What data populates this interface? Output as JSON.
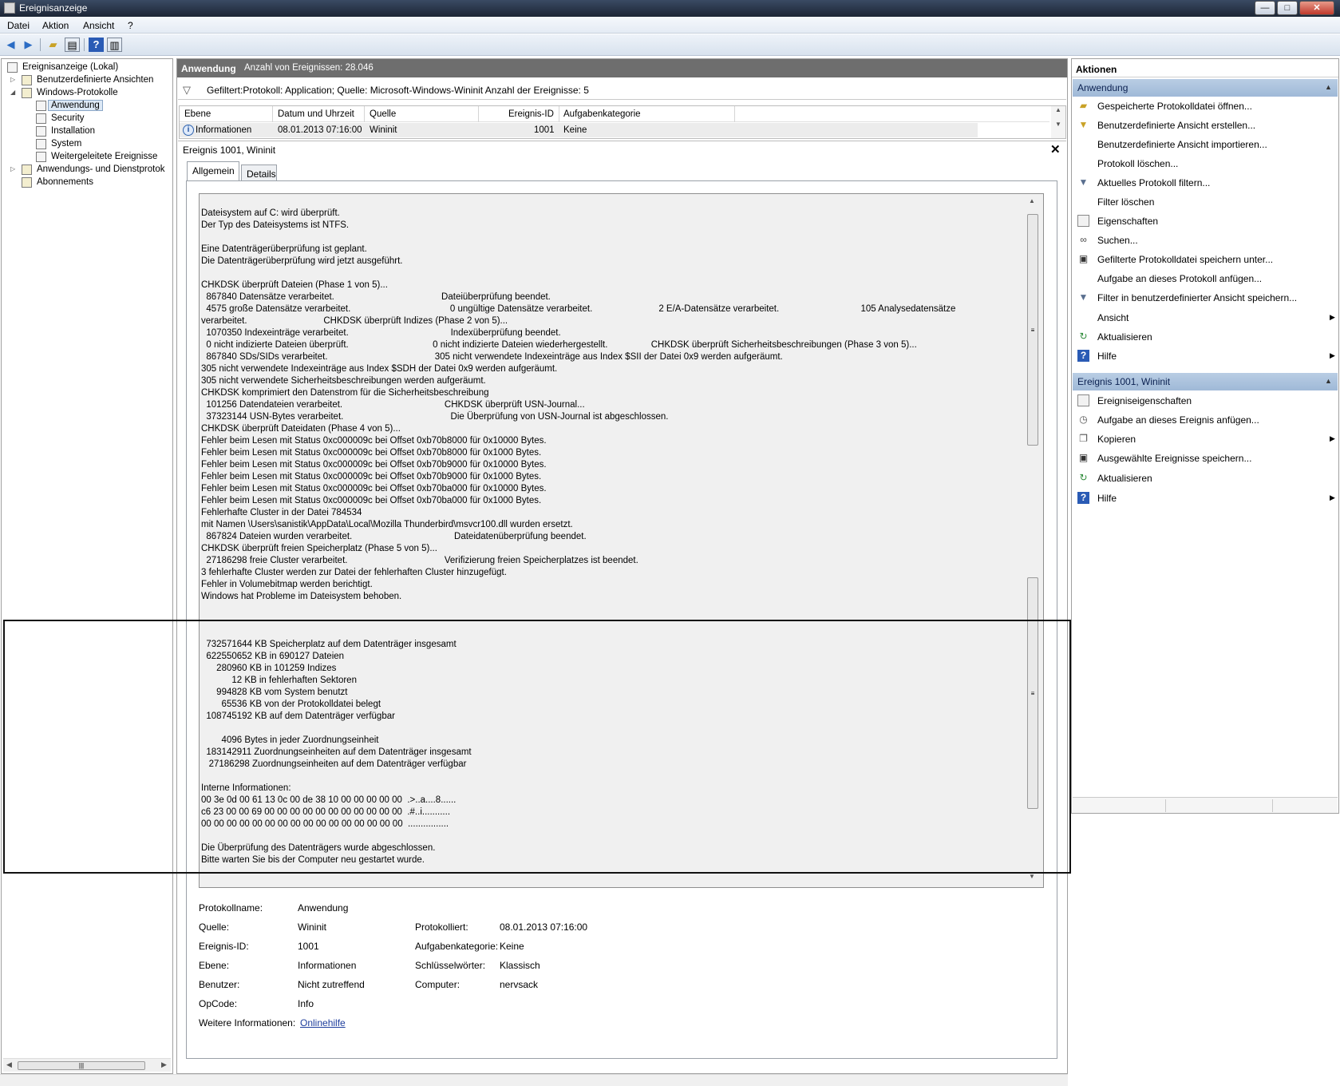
{
  "window": {
    "title": "Ereignisanzeige"
  },
  "menu": [
    "Datei",
    "Aktion",
    "Ansicht",
    "?"
  ],
  "tree": {
    "items": [
      {
        "label": "Ereignisanzeige (Lokal)"
      },
      {
        "label": "Benutzerdefinierte Ansichten"
      },
      {
        "label": "Windows-Protokolle"
      },
      {
        "label": "Anwendung"
      },
      {
        "label": "Security"
      },
      {
        "label": "Installation"
      },
      {
        "label": "System"
      },
      {
        "label": "Weitergeleitete Ereignisse"
      },
      {
        "label": "Anwendungs- und Dienstprotok"
      },
      {
        "label": "Abonnements"
      }
    ]
  },
  "center": {
    "header_title": "Anwendung",
    "header_count": "Anzahl von Ereignissen: 28.046",
    "filter_text": "Gefiltert:Protokoll: Application; Quelle: Microsoft-Windows-Wininit Anzahl der Ereignisse: 5",
    "columns": [
      "Ebene",
      "Datum und Uhrzeit",
      "Quelle",
      "Ereignis-ID",
      "Aufgabenkategorie"
    ],
    "row": {
      "level": "Informationen",
      "datetime": "08.01.2013 07:16:00",
      "source": "Wininit",
      "event_id": "1001",
      "category": "Keine"
    },
    "detail_title": "Ereignis 1001, Wininit",
    "tabs": [
      "Allgemein",
      "Details"
    ]
  },
  "message": {
    "text": "Dateisystem auf C: wird überprüft.\nDer Typ des Dateisystems ist NTFS.\n\nEine Datenträgerüberprüfung ist geplant.\nDie Datenträgerüberprüfung wird jetzt ausgeführt.\n\nCHKDSK überprüft Dateien (Phase 1 von 5)...\n  867840 Datensätze verarbeitet.                                          Dateiüberprüfung beendet.\n  4575 große Datensätze verarbeitet.                                       0 ungültige Datensätze verarbeitet.                          2 E/A-Datensätze verarbeitet.                                105 Analysedatensätze\nverarbeitet.                              CHKDSK überprüft Indizes (Phase 2 von 5)...\n  1070350 Indexeinträge verarbeitet.                                        Indexüberprüfung beendet.\n  0 nicht indizierte Dateien überprüft.                                 0 nicht indizierte Dateien wiederhergestellt.                 CHKDSK überprüft Sicherheitsbeschreibungen (Phase 3 von 5)...\n  867840 SDs/SIDs verarbeitet.                                          305 nicht verwendete Indexeinträge aus Index $SII der Datei 0x9 werden aufgeräumt.\n305 nicht verwendete Indexeinträge aus Index $SDH der Datei 0x9 werden aufgeräumt.\n305 nicht verwendete Sicherheitsbeschreibungen werden aufgeräumt.\nCHKDSK komprimiert den Datenstrom für die Sicherheitsbeschreibung\n  101256 Datendateien verarbeitet.                                        CHKDSK überprüft USN-Journal...\n  37323144 USN-Bytes verarbeitet.                                          Die Überprüfung von USN-Journal ist abgeschlossen.\nCHKDSK überprüft Dateidaten (Phase 4 von 5)...\nFehler beim Lesen mit Status 0xc000009c bei Offset 0xb70b8000 für 0x10000 Bytes.\nFehler beim Lesen mit Status 0xc000009c bei Offset 0xb70b8000 für 0x1000 Bytes.\nFehler beim Lesen mit Status 0xc000009c bei Offset 0xb70b9000 für 0x10000 Bytes.\nFehler beim Lesen mit Status 0xc000009c bei Offset 0xb70b9000 für 0x1000 Bytes.\nFehler beim Lesen mit Status 0xc000009c bei Offset 0xb70ba000 für 0x10000 Bytes.\nFehler beim Lesen mit Status 0xc000009c bei Offset 0xb70ba000 für 0x1000 Bytes.\nFehlerhafte Cluster in der Datei 784534\nmit Namen \\Users\\sanistik\\AppData\\Local\\Mozilla Thunderbird\\msvcr100.dll wurden ersetzt.\n  867824 Dateien wurden verarbeitet.                                        Dateidatenüberprüfung beendet.\nCHKDSK überprüft freien Speicherplatz (Phase 5 von 5)...\n  27186298 freie Cluster verarbeitet.                                      Verifizierung freien Speicherplatzes ist beendet.\n3 fehlerhafte Cluster werden zur Datei der fehlerhaften Cluster hinzugefügt.\nFehler in Volumebitmap werden berichtigt.\nWindows hat Probleme im Dateisystem behoben.\n\n\n\n  732571644 KB Speicherplatz auf dem Datenträger insgesamt\n  622550652 KB in 690127 Dateien\n      280960 KB in 101259 Indizes\n            12 KB in fehlerhaften Sektoren\n      994828 KB vom System benutzt\n        65536 KB von der Protokolldatei belegt\n  108745192 KB auf dem Datenträger verfügbar\n\n        4096 Bytes in jeder Zuordnungseinheit\n  183142911 Zuordnungseinheiten auf dem Datenträger insgesamt\n   27186298 Zuordnungseinheiten auf dem Datenträger verfügbar\n\nInterne Informationen:\n00 3e 0d 00 61 13 0c 00 de 38 10 00 00 00 00 00  .>..a....8......\nc6 23 00 00 69 00 00 00 00 00 00 00 00 00 00 00  .#..i...........\n00 00 00 00 00 00 00 00 00 00 00 00 00 00 00 00  ................\n\nDie Überprüfung des Datenträgers wurde abgeschlossen.\nBitte warten Sie bis der Computer neu gestartet wurde."
  },
  "props": {
    "protokollname_label": "Protokollname:",
    "protokollname": "Anwendung",
    "quelle_label": "Quelle:",
    "quelle": "Wininit",
    "protokolliert_label": "Protokolliert:",
    "protokolliert": "08.01.2013 07:16:00",
    "ereignis_id_label": "Ereignis-ID:",
    "ereignis_id": "1001",
    "aufgabenkategorie_label": "Aufgabenkategorie:",
    "aufgabenkategorie": "Keine",
    "ebene_label": "Ebene:",
    "ebene": "Informationen",
    "schluesselwoerter_label": "Schlüsselwörter:",
    "schluesselwoerter": "Klassisch",
    "benutzer_label": "Benutzer:",
    "benutzer": "Nicht zutreffend",
    "computer_label": "Computer:",
    "computer": "nervsack",
    "opcode_label": "OpCode:",
    "opcode": "Info",
    "weitere_label": "Weitere Informationen:",
    "weitere_link": "Onlinehilfe"
  },
  "actions": {
    "title": "Aktionen",
    "section1": "Anwendung",
    "items1": [
      {
        "label": "Gespeicherte Protokolldatei öffnen...",
        "icon": "folder-open-icon"
      },
      {
        "label": "Benutzerdefinierte Ansicht erstellen...",
        "icon": "filter-create-icon"
      },
      {
        "label": "Benutzerdefinierte Ansicht importieren...",
        "icon": ""
      },
      {
        "label": "Protokoll löschen...",
        "icon": ""
      },
      {
        "label": "Aktuelles Protokoll filtern...",
        "icon": "filter-icon"
      },
      {
        "label": "Filter löschen",
        "icon": ""
      },
      {
        "label": "Eigenschaften",
        "icon": "properties-icon"
      },
      {
        "label": "Suchen...",
        "icon": "binoculars-icon"
      },
      {
        "label": "Gefilterte Protokolldatei speichern unter...",
        "icon": "save-icon"
      },
      {
        "label": "Aufgabe an dieses Protokoll anfügen...",
        "icon": ""
      },
      {
        "label": "Filter in benutzerdefinierter Ansicht speichern...",
        "icon": "filter-save-icon"
      },
      {
        "label": "Ansicht",
        "icon": ""
      },
      {
        "label": "Aktualisieren",
        "icon": "refresh-icon"
      },
      {
        "label": "Hilfe",
        "icon": "help-icon"
      }
    ],
    "section2": "Ereignis 1001, Wininit",
    "items2": [
      {
        "label": "Ereigniseigenschaften",
        "icon": "properties-icon"
      },
      {
        "label": "Aufgabe an dieses Ereignis anfügen...",
        "icon": "task-icon"
      },
      {
        "label": "Kopieren",
        "icon": "copy-icon"
      },
      {
        "label": "Ausgewählte Ereignisse speichern...",
        "icon": "save-icon"
      },
      {
        "label": "Aktualisieren",
        "icon": "refresh-icon"
      },
      {
        "label": "Hilfe",
        "icon": "help-icon"
      }
    ]
  },
  "colors": {
    "selection": "#dde9f6",
    "section_header": "#b9cde4",
    "center_header": "#6e6e6e",
    "link": "#1d3d9c"
  }
}
